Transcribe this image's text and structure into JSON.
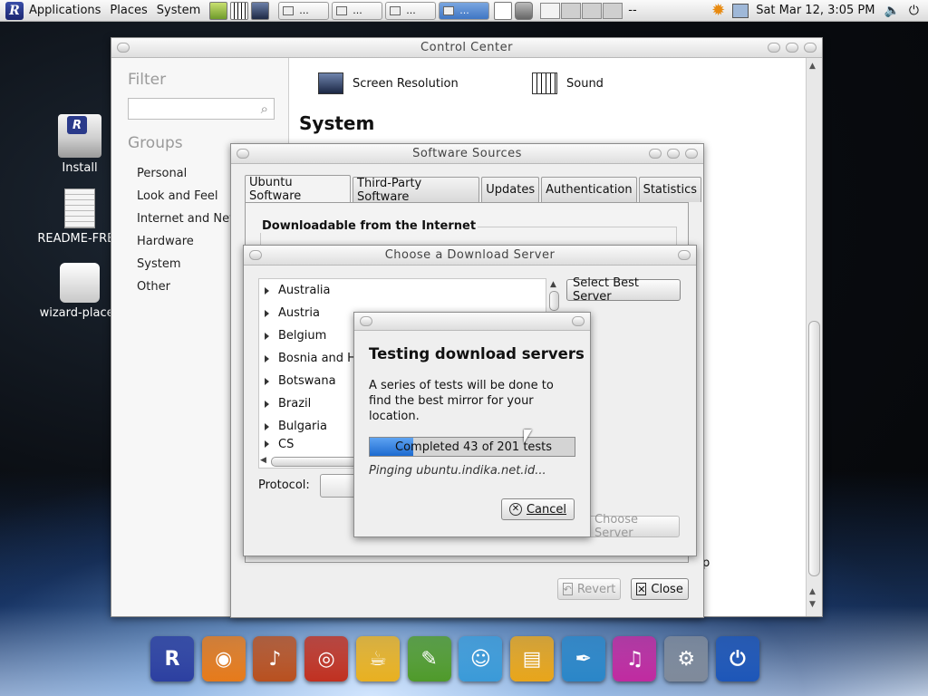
{
  "top_panel": {
    "menus": [
      "Applications",
      "Places",
      "System"
    ],
    "tasks": [
      "...",
      "...",
      "...",
      "..."
    ],
    "workspace_extra": "--",
    "clock": "Sat Mar 12,  3:05 PM"
  },
  "desktop": {
    "icons": [
      {
        "label": "Install"
      },
      {
        "label": "README-FREE"
      },
      {
        "label": "wizard-places"
      }
    ]
  },
  "control_center": {
    "title": "Control Center",
    "filter_heading": "Filter",
    "filter_value": "",
    "groups_heading": "Groups",
    "groups": [
      "Personal",
      "Look and Feel",
      "Internet and Net",
      "Hardware",
      "System",
      "Other"
    ],
    "apps": [
      {
        "label": "Screen Resolution",
        "icon": "monitor-icon"
      },
      {
        "label": "Sound",
        "icon": "piano-icon"
      }
    ],
    "section_heading": "System",
    "partial_label": "p"
  },
  "software_sources": {
    "title": "Software Sources",
    "tabs": [
      "Ubuntu Software",
      "Third-Party Software",
      "Updates",
      "Authentication",
      "Statistics"
    ],
    "active_tab": "Ubuntu Software",
    "frame_label": "Downloadable from the Internet",
    "revert_label": "Revert",
    "close_label": "Close"
  },
  "choose_server": {
    "title": "Choose a Download Server",
    "countries": [
      "Australia",
      "Austria",
      "Belgium",
      "Bosnia and H",
      "Botswana",
      "Brazil",
      "Bulgaria",
      "CS"
    ],
    "select_best_label": "Select Best Server",
    "protocol_label": "Protocol:",
    "choose_server_label": "Choose Server"
  },
  "testing_dialog": {
    "heading": "Testing download servers",
    "description": "A series of tests will be done to find the best mirror for your location.",
    "progress_text": "Completed 43 of 201 tests",
    "progress_completed": 43,
    "progress_total": 201,
    "status": "Pinging ubuntu.indika.net.id...",
    "cancel_label": "Cancel"
  },
  "dock": {
    "items": [
      {
        "icon": "r-logo-icon",
        "color": "#2c3fa0"
      },
      {
        "icon": "browser-icon",
        "color": "#e67a1a"
      },
      {
        "icon": "guitar-icon",
        "color": "#b8501f"
      },
      {
        "icon": "media-player-icon",
        "color": "#c03020"
      },
      {
        "icon": "coffee-cup-icon",
        "color": "#e8b020"
      },
      {
        "icon": "image-editor-icon",
        "color": "#4f9a2a"
      },
      {
        "icon": "messenger-icon",
        "color": "#3a9ad8"
      },
      {
        "icon": "office-icon",
        "color": "#e8a51a"
      },
      {
        "icon": "feather-icon",
        "color": "#2a86c8"
      },
      {
        "icon": "music-note-icon",
        "color": "#c02aa0"
      },
      {
        "icon": "settings-icon",
        "color": "#7f8a9a"
      },
      {
        "icon": "power-icon",
        "color": "#1d56b8"
      }
    ]
  },
  "colors": {
    "progress_fill": "#1c6ad0",
    "active_task": "#3f76c4"
  }
}
